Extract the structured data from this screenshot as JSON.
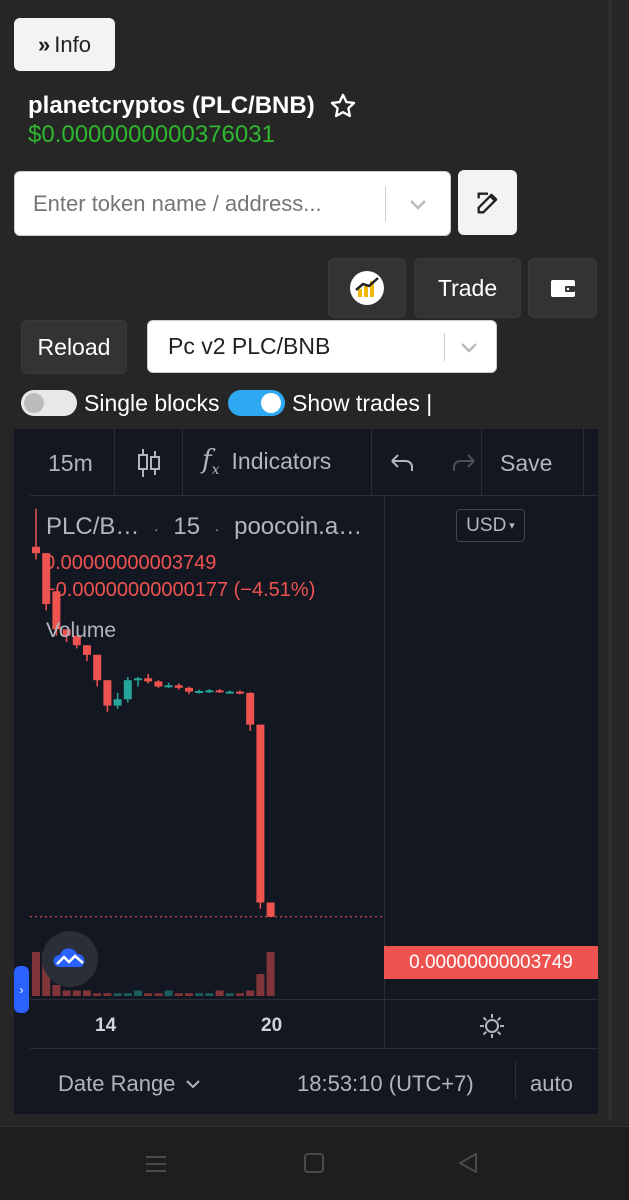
{
  "header": {
    "info_label": "Info",
    "token_title": "planetcryptos (PLC/BNB)",
    "price": "$0.0000000000376031"
  },
  "search": {
    "placeholder": "Enter token name / address..."
  },
  "actions": {
    "trade_label": "Trade"
  },
  "controls": {
    "reload_label": "Reload",
    "pair_select_value": "Pc v2 PLC/BNB",
    "single_blocks_label": "Single blocks",
    "show_trades_label": "Show trades |",
    "single_blocks_on": false,
    "show_trades_on": true
  },
  "chart_toolbar": {
    "interval": "15m",
    "indicators_label": "Indicators",
    "save_label": "Save"
  },
  "chart_legend": {
    "symbol": "PLC/B…",
    "interval": "15",
    "source": "poocoin.a…",
    "value": "0.00000000003749",
    "change": "−0.00000000000177 (−4.51%)",
    "volume_label": "Volume",
    "currency": "USD"
  },
  "price_axis": {
    "last_price_label": "0.00000000003749"
  },
  "time_axis": {
    "labels": [
      "14",
      "20"
    ]
  },
  "chart_footer": {
    "date_range_label": "Date Range",
    "clock": "18:53:10 (UTC+7)",
    "scale_label": "auto"
  },
  "colors": {
    "up": "#26a69a",
    "down": "#ef5350",
    "price_green": "#2eb82e",
    "toggle_on": "#2ea9f2"
  },
  "chart_data": {
    "type": "candlestick",
    "candles": [
      {
        "o": 62,
        "h": 68,
        "l": 60,
        "c": 61
      },
      {
        "o": 61,
        "h": 61,
        "l": 52,
        "c": 53
      },
      {
        "o": 55,
        "h": 55,
        "l": 48,
        "c": 49
      },
      {
        "o": 49,
        "h": 49,
        "l": 47,
        "c": 48
      },
      {
        "o": 48,
        "h": 48,
        "l": 46,
        "c": 46.5
      },
      {
        "o": 46.5,
        "h": 46.5,
        "l": 44,
        "c": 45
      },
      {
        "o": 45,
        "h": 45,
        "l": 40,
        "c": 41
      },
      {
        "o": 41,
        "h": 41,
        "l": 36,
        "c": 37
      },
      {
        "o": 37,
        "h": 39,
        "l": 36.5,
        "c": 38
      },
      {
        "o": 38,
        "h": 41.5,
        "l": 37.5,
        "c": 41
      },
      {
        "o": 41,
        "h": 41.5,
        "l": 40,
        "c": 41.3
      },
      {
        "o": 41.3,
        "h": 42,
        "l": 40.5,
        "c": 40.8
      },
      {
        "o": 40.8,
        "h": 41,
        "l": 39.8,
        "c": 40
      },
      {
        "o": 40,
        "h": 40.6,
        "l": 39.8,
        "c": 40.2
      },
      {
        "o": 40.2,
        "h": 40.5,
        "l": 39.5,
        "c": 39.8
      },
      {
        "o": 39.8,
        "h": 40,
        "l": 38.8,
        "c": 39.2
      },
      {
        "o": 39.2,
        "h": 39.5,
        "l": 38.9,
        "c": 39.3
      },
      {
        "o": 39.3,
        "h": 39.6,
        "l": 39,
        "c": 39.4
      },
      {
        "o": 39.4,
        "h": 39.6,
        "l": 39,
        "c": 39.1
      },
      {
        "o": 39.1,
        "h": 39.4,
        "l": 38.9,
        "c": 39.2
      },
      {
        "o": 39.2,
        "h": 39.4,
        "l": 38.8,
        "c": 39.0
      },
      {
        "o": 39.0,
        "h": 39.1,
        "l": 33,
        "c": 34
      },
      {
        "o": 34,
        "h": 34,
        "l": 5,
        "c": 6
      },
      {
        "o": 6,
        "h": 6,
        "l": 3.749,
        "c": 3.749
      }
    ],
    "volumes": [
      8,
      8,
      2,
      1,
      1,
      1,
      0.5,
      0.5,
      0.5,
      0.5,
      1,
      0.5,
      0.5,
      1,
      0.5,
      0.5,
      0.5,
      0.5,
      1,
      0.5,
      0.5,
      1,
      4,
      8
    ],
    "last_price": 3.749
  }
}
